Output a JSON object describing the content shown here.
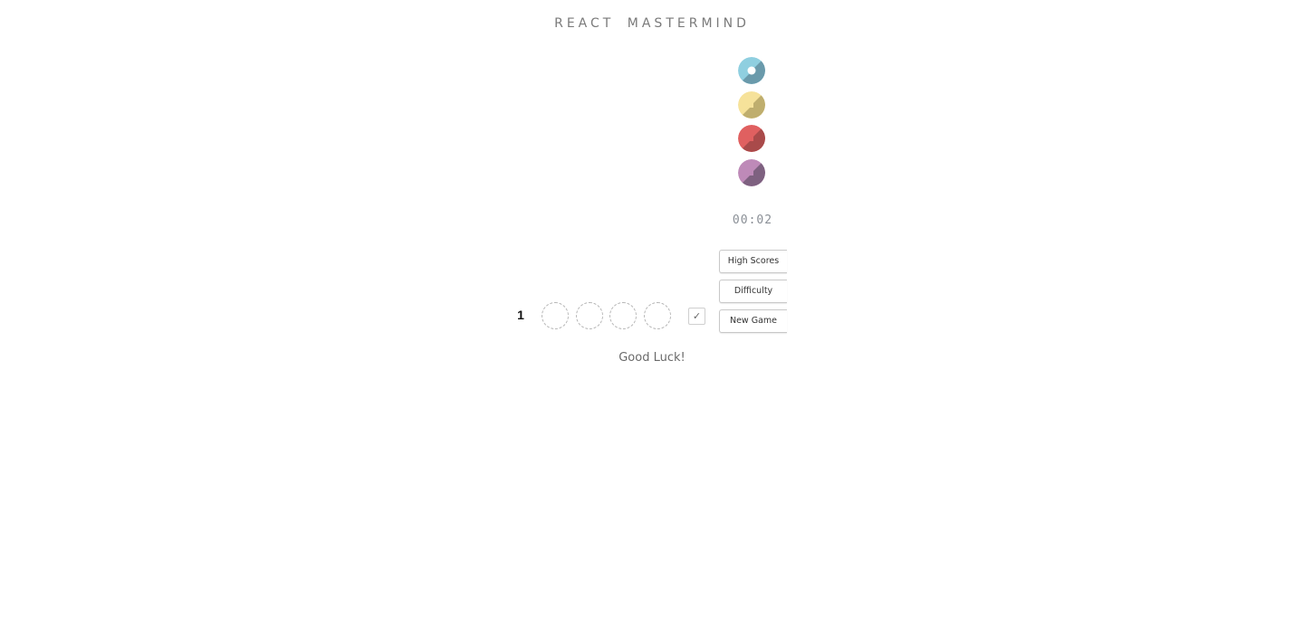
{
  "header": {
    "title": "REACT  MASTERMIND"
  },
  "palette": {
    "pegs": [
      {
        "name": "blue",
        "color": "#8fcfe0",
        "shade": "#6a9aab",
        "selected": true
      },
      {
        "name": "yellow",
        "color": "#f6e29a",
        "shade": "#bfae6e"
      },
      {
        "name": "red",
        "color": "#e06060",
        "shade": "#a94a4a"
      },
      {
        "name": "purple",
        "color": "#be8ab8",
        "shade": "#7e6180"
      }
    ]
  },
  "timer": {
    "value": "00:02"
  },
  "menu": {
    "high_scores_label": "High Scores",
    "difficulty_label": "Difficulty",
    "new_game_label": "New Game"
  },
  "board": {
    "current_row_number": "1",
    "holes": 4,
    "check_label": "✓"
  },
  "status": {
    "message": "Good Luck!"
  },
  "colors": {
    "text_muted": "#7a7a7a",
    "hole_border": "#b5b5b5"
  }
}
